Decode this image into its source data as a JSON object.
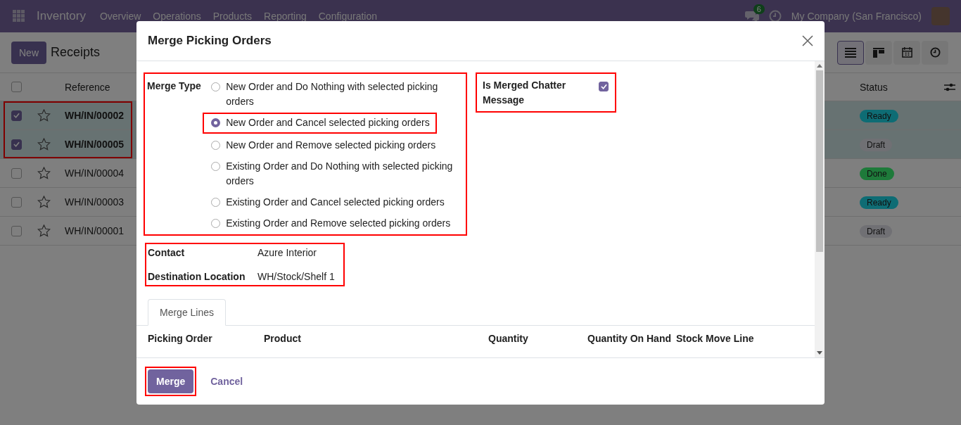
{
  "navbar": {
    "app": "Inventory",
    "menus": [
      "Overview",
      "Operations",
      "Products",
      "Reporting",
      "Configuration"
    ],
    "chat_badge": "6",
    "company": "My Company (San Francisco)"
  },
  "control_panel": {
    "new_button": "New",
    "title": "Receipts",
    "views": [
      {
        "kind": "list",
        "selected": true
      },
      {
        "kind": "kanban",
        "selected": false
      },
      {
        "kind": "calendar",
        "selected": false
      },
      {
        "kind": "activity",
        "selected": false
      }
    ]
  },
  "table": {
    "columns": [
      "Reference",
      "Status"
    ],
    "all_checked": false,
    "highlighted": true,
    "rows": [
      {
        "reference": "WH/IN/00002",
        "status": "Ready",
        "color": "#0e6c74",
        "selected": true
      },
      {
        "reference": "WH/IN/00005",
        "status": "Draft",
        "color": "#707074",
        "selected": true
      },
      {
        "reference": "WH/IN/00004",
        "status": "Done",
        "color": "#1e7a3a",
        "selected": false
      },
      {
        "reference": "WH/IN/00003",
        "status": "Ready",
        "color": "#0e6c74",
        "selected": false
      },
      {
        "reference": "WH/IN/00001",
        "status": "Draft",
        "color": "#707074",
        "selected": false
      }
    ]
  },
  "dialog": {
    "title": "Merge Picking Orders",
    "merge_type": {
      "label": "Merge Type",
      "highlighted": true,
      "options": [
        {
          "label": "New Order and Do Nothing with selected picking orders",
          "selected": false,
          "highlighted": false
        },
        {
          "label": "New Order and Cancel selected picking orders",
          "selected": true,
          "highlighted": true
        },
        {
          "label": "New Order and Remove selected picking orders",
          "selected": false,
          "highlighted": false
        },
        {
          "label": "Existing Order and Do Nothing with selected picking orders",
          "selected": false,
          "highlighted": false
        },
        {
          "label": "Existing Order and Cancel selected picking orders",
          "selected": false,
          "highlighted": false
        },
        {
          "label": "Existing Order and Remove selected picking orders",
          "selected": false,
          "highlighted": false
        }
      ]
    },
    "chatter": {
      "label": "Is Merged Chatter Message",
      "checked": true,
      "highlighted": true
    },
    "fields": {
      "highlighted": true,
      "items": [
        {
          "label": "Contact",
          "value": "Azure Interior"
        },
        {
          "label": "Destination Location",
          "value": "WH/Stock/Shelf 1"
        }
      ]
    },
    "tabs": [
      {
        "label": "Merge Lines",
        "selected": true
      }
    ],
    "lines_columns": [
      "Picking Order",
      "Product",
      "Quantity",
      "Quantity On Hand",
      "Stock Move Line"
    ],
    "buttons": [
      {
        "label": "Merge",
        "kind": "primary",
        "highlighted": true
      },
      {
        "label": "Cancel",
        "kind": "link",
        "highlighted": false
      }
    ]
  }
}
